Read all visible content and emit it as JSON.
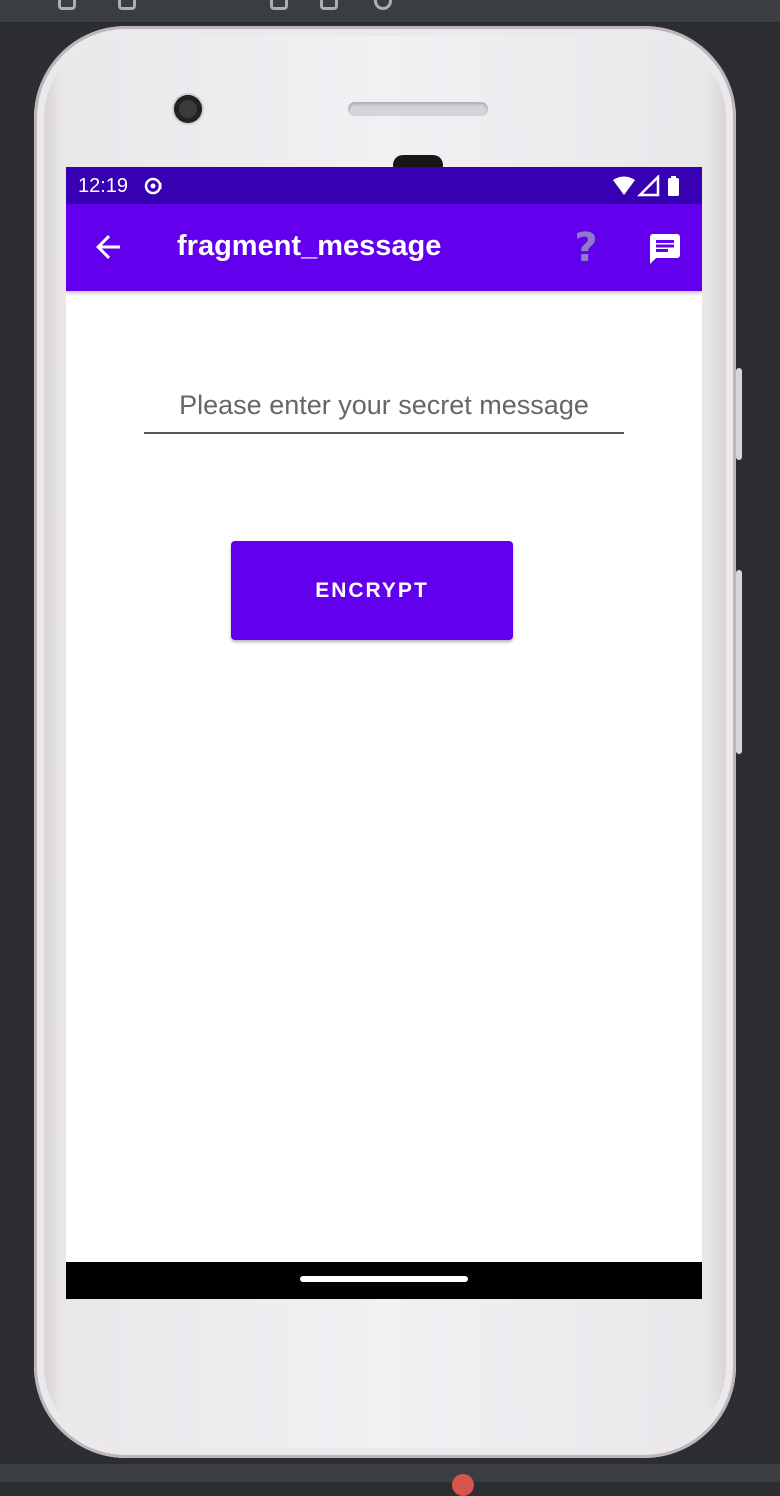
{
  "status_bar": {
    "time": "12:19"
  },
  "app_bar": {
    "title": "fragment_message"
  },
  "form": {
    "input_placeholder": "Please enter your secret message",
    "input_value": "",
    "encrypt_label": "ENCRYPT"
  },
  "colors": {
    "primary": "#6200ee",
    "primary_dark": "#3700b3",
    "nav_bar": "#000000",
    "background": "#ffffff"
  },
  "icons": {
    "back": "arrow-back-icon",
    "help": "help-icon",
    "message": "message-icon",
    "wifi": "wifi-icon",
    "cell": "cell-signal-icon",
    "battery": "battery-icon",
    "notification": "notification-icon"
  }
}
